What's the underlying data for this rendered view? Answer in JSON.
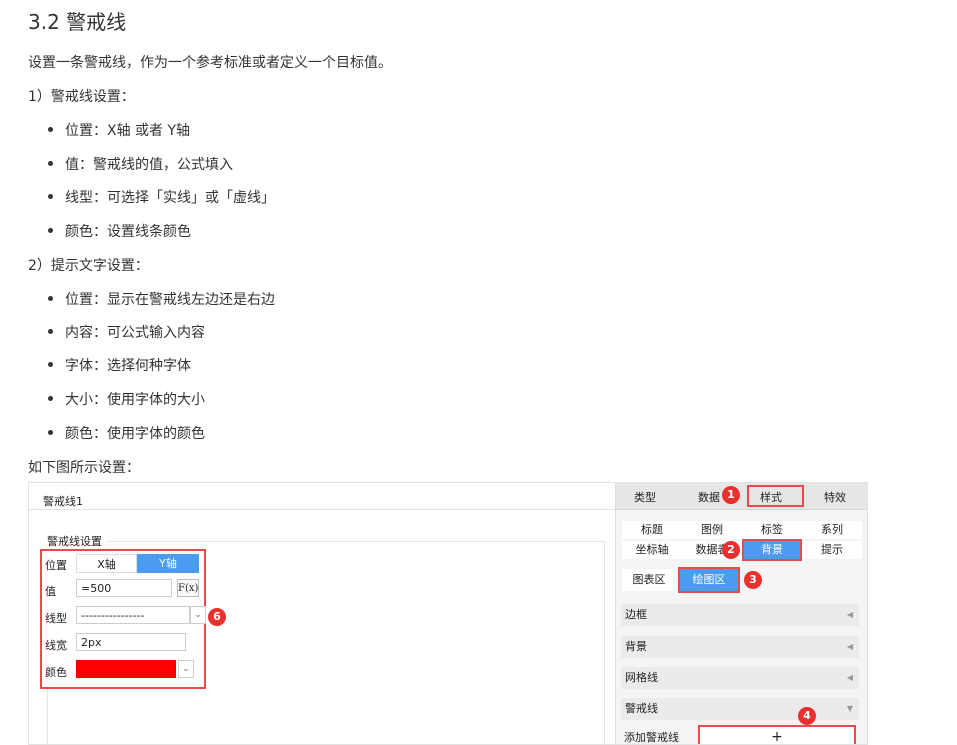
{
  "doc": {
    "heading": "3.2 警戒线",
    "intro": "设置一条警戒线，作为一个参考标准或者定义一个目标值。",
    "section1_title": "1）警戒线设置：",
    "section1_items": [
      "位置：X轴 或者 Y轴",
      "值：警戒线的值，公式填入",
      "线型：可选择「实线」或「虚线」",
      "颜色：设置线条颜色"
    ],
    "section2_title": "2）提示文字设置：",
    "section2_items": [
      "位置：显示在警戒线左边还是右边",
      "内容：可公式输入内容",
      "字体：选择何种字体",
      "大小：使用字体的大小",
      "颜色：使用字体的颜色"
    ],
    "figure_caption": "如下图所示设置："
  },
  "screenshot": {
    "panel_title": "警戒线1",
    "group_label": "警戒线设置",
    "form": {
      "position_label": "位置",
      "x_axis": "X轴",
      "y_axis": "Y轴",
      "value_label": "值",
      "value": "=500",
      "fx_label": "F(x)",
      "linetype_label": "线型",
      "linetype_value": "----------------",
      "linewidth_label": "线宽",
      "linewidth_value": "2px",
      "color_label": "颜色",
      "color_value": "#ff0000"
    },
    "tabs": [
      "类型",
      "数据",
      "样式",
      "特效"
    ],
    "subtabs_row1": [
      "标题",
      "图例",
      "标签",
      "系列"
    ],
    "subtabs_row2": [
      "坐标轴",
      "数据表",
      "背景",
      "提示"
    ],
    "subtabs_row3": [
      "图表区",
      "绘图区"
    ],
    "accordion": [
      "边框",
      "背景",
      "网格线",
      "警戒线"
    ],
    "add_label": "添加警戒线",
    "add_button": "+",
    "markers": [
      "1",
      "2",
      "3",
      "4",
      "6"
    ]
  }
}
